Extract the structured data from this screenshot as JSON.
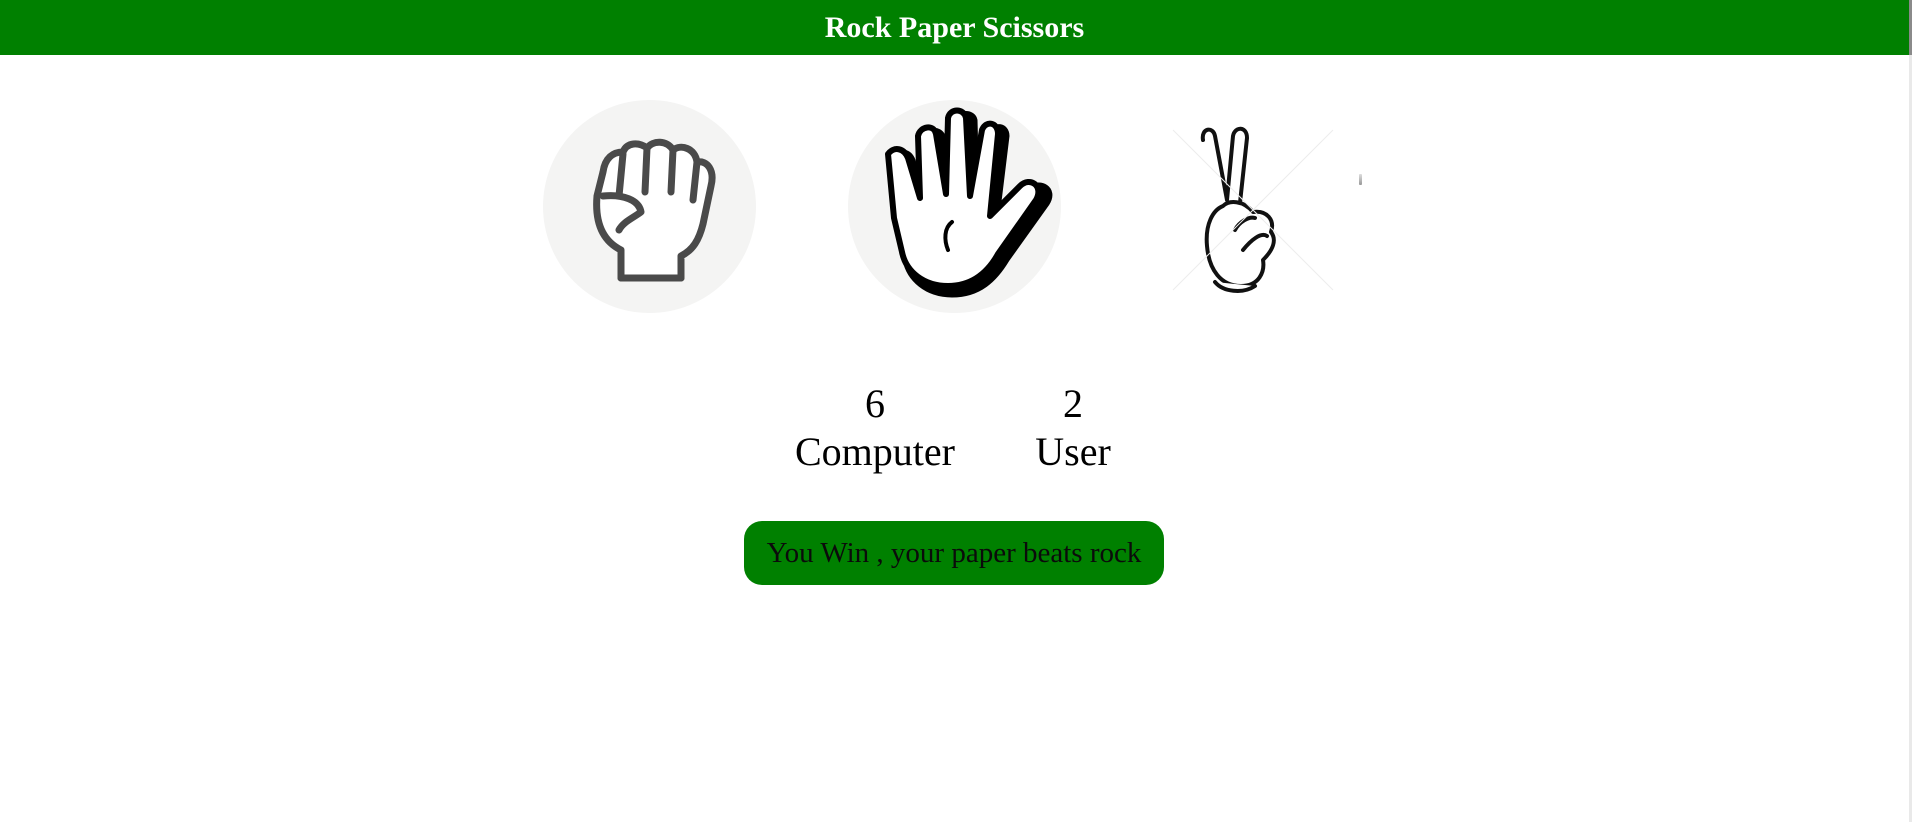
{
  "header": {
    "title": "Rock Paper Scissors",
    "background": "#008000"
  },
  "choices": [
    {
      "id": "rock",
      "icon": "fist-icon"
    },
    {
      "id": "paper",
      "icon": "open-hand-icon"
    },
    {
      "id": "scissors",
      "icon": "victory-hand-icon"
    }
  ],
  "scoreboard": {
    "computer": {
      "score": "6",
      "label": "Computer"
    },
    "user": {
      "score": "2",
      "label": "User"
    }
  },
  "result": {
    "message": "You Win , your paper beats rock",
    "color": "#008000"
  }
}
